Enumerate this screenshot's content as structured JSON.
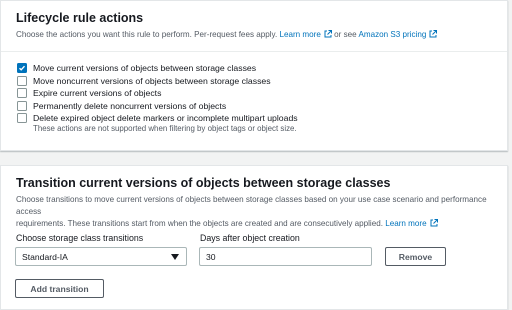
{
  "lifecycle": {
    "title": "Lifecycle rule actions",
    "desc_prefix": "Choose the actions you want this rule to perform. Per-request fees apply.",
    "learn_more": "Learn more",
    "or_see": "or see",
    "pricing_link": "Amazon S3 pricing",
    "actions": [
      {
        "label": "Move current versions of objects between storage classes",
        "checked": true
      },
      {
        "label": "Move noncurrent versions of objects between storage classes",
        "checked": false
      },
      {
        "label": "Expire current versions of objects",
        "checked": false
      },
      {
        "label": "Permanently delete noncurrent versions of objects",
        "checked": false
      },
      {
        "label": "Delete expired object delete markers or incomplete multipart uploads",
        "checked": false
      }
    ],
    "hint": "These actions are not supported when filtering by object tags or object size."
  },
  "transition": {
    "title": "Transition current versions of objects between storage classes",
    "desc_line1": "Choose transitions to move current versions of objects between storage classes based on your use case scenario and performance access",
    "desc_line2": "requirements. These transitions start from when the objects are created and are consecutively applied.",
    "learn_more": "Learn more",
    "storage_label": "Choose storage class transitions",
    "storage_value": "Standard-IA",
    "days_label": "Days after object creation",
    "days_value": "30",
    "remove_label": "Remove",
    "add_label": "Add transition"
  },
  "colors": {
    "accent": "#0073bb",
    "border": "#aab7b8",
    "background": "#f2f3f3"
  }
}
